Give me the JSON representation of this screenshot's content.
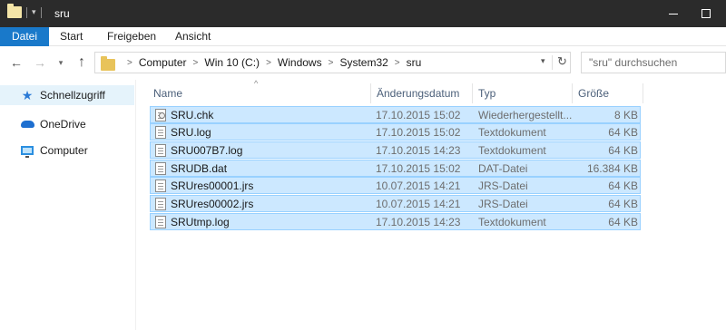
{
  "window": {
    "title": "sru"
  },
  "ribbon": {
    "tabs": [
      "Datei",
      "Start",
      "Freigeben",
      "Ansicht"
    ]
  },
  "address": {
    "crumbs": [
      "Computer",
      "Win 10 (C:)",
      "Windows",
      "System32",
      "sru"
    ]
  },
  "search": {
    "placeholder": "\"sru\" durchsuchen"
  },
  "sidebar": {
    "items": [
      {
        "label": "Schnellzugriff",
        "icon": "star-icon"
      },
      {
        "label": "OneDrive",
        "icon": "cloud-icon"
      },
      {
        "label": "Computer",
        "icon": "computer-icon"
      }
    ]
  },
  "columns": {
    "name": "Name",
    "date": "Änderungsdatum",
    "type": "Typ",
    "size": "Größe"
  },
  "files": [
    {
      "name": "SRU.chk",
      "date": "17.10.2015 15:02",
      "type": "Wiederhergestellt...",
      "size": "8 KB"
    },
    {
      "name": "SRU.log",
      "date": "17.10.2015 15:02",
      "type": "Textdokument",
      "size": "64 KB"
    },
    {
      "name": "SRU007B7.log",
      "date": "17.10.2015 14:23",
      "type": "Textdokument",
      "size": "64 KB"
    },
    {
      "name": "SRUDB.dat",
      "date": "17.10.2015 15:02",
      "type": "DAT-Datei",
      "size": "16.384 KB"
    },
    {
      "name": "SRUres00001.jrs",
      "date": "10.07.2015 14:21",
      "type": "JRS-Datei",
      "size": "64 KB"
    },
    {
      "name": "SRUres00002.jrs",
      "date": "10.07.2015 14:21",
      "type": "JRS-Datei",
      "size": "64 KB"
    },
    {
      "name": "SRUtmp.log",
      "date": "17.10.2015 14:23",
      "type": "Textdokument",
      "size": "64 KB"
    }
  ],
  "colors": {
    "accent": "#1979ca",
    "selection": "#cce8ff",
    "selection_border": "#99d1ff",
    "titlebar": "#2b2b2b"
  }
}
